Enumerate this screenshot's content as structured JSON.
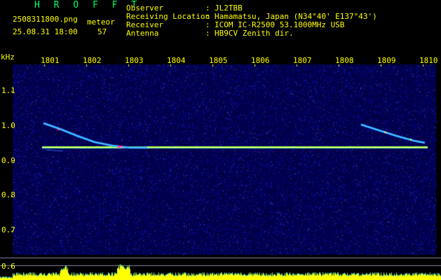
{
  "header": {
    "brand": "H R O F F T",
    "filename": "2508311800.png",
    "meteor_label": "meteor",
    "datetime": "25.08.31 18:00",
    "meteor_count": "57",
    "fields": [
      {
        "label": "Observer",
        "sep": ":",
        "value": "JL2TBB"
      },
      {
        "label": "Receiving Location",
        "sep": ":",
        "value": "Hamamatsu, Japan (N34°40' E137°43')"
      },
      {
        "label": "Receiver",
        "sep": ":",
        "value": "ICOM IC-R2500 53.1000MHz USB"
      },
      {
        "label": "Antenna",
        "sep": ":",
        "value": "HB9CV Zenith dir."
      }
    ]
  },
  "axes": {
    "y_unit": "kHz",
    "x_ticks": [
      "1801",
      "1802",
      "1803",
      "1804",
      "1805",
      "1806",
      "1807",
      "1808",
      "1809",
      "1810"
    ],
    "y_ticks": [
      "1.1",
      "1.0",
      "0.9",
      "0.8",
      "0.7",
      "0.6"
    ]
  },
  "colors": {
    "text": "#ffff00",
    "brand": "#00ff66",
    "noise_base": "#00007a",
    "carrier": "#ffff66",
    "meteor_trail": "#44ddff",
    "hline": "#9999bb",
    "level_bar": "#ffff00",
    "level_edge": "#00ccff"
  }
}
